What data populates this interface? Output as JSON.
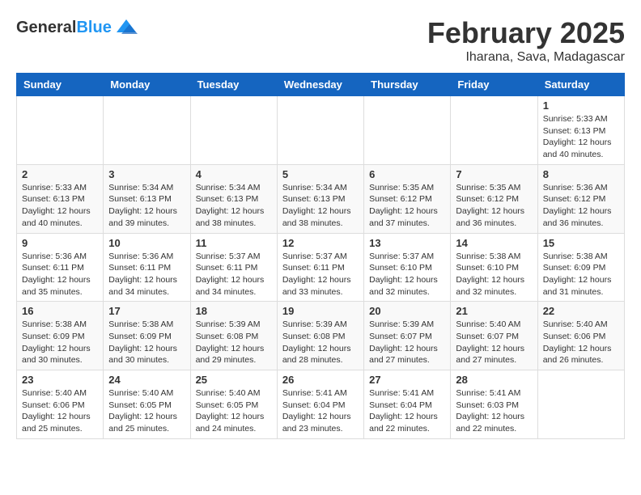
{
  "header": {
    "logo_line1": "General",
    "logo_line2": "Blue",
    "month": "February 2025",
    "location": "Iharana, Sava, Madagascar"
  },
  "days_of_week": [
    "Sunday",
    "Monday",
    "Tuesday",
    "Wednesday",
    "Thursday",
    "Friday",
    "Saturday"
  ],
  "weeks": [
    {
      "days": [
        {
          "num": "",
          "info": ""
        },
        {
          "num": "",
          "info": ""
        },
        {
          "num": "",
          "info": ""
        },
        {
          "num": "",
          "info": ""
        },
        {
          "num": "",
          "info": ""
        },
        {
          "num": "",
          "info": ""
        },
        {
          "num": "1",
          "info": "Sunrise: 5:33 AM\nSunset: 6:13 PM\nDaylight: 12 hours\nand 40 minutes."
        }
      ]
    },
    {
      "days": [
        {
          "num": "2",
          "info": "Sunrise: 5:33 AM\nSunset: 6:13 PM\nDaylight: 12 hours\nand 40 minutes."
        },
        {
          "num": "3",
          "info": "Sunrise: 5:34 AM\nSunset: 6:13 PM\nDaylight: 12 hours\nand 39 minutes."
        },
        {
          "num": "4",
          "info": "Sunrise: 5:34 AM\nSunset: 6:13 PM\nDaylight: 12 hours\nand 38 minutes."
        },
        {
          "num": "5",
          "info": "Sunrise: 5:34 AM\nSunset: 6:13 PM\nDaylight: 12 hours\nand 38 minutes."
        },
        {
          "num": "6",
          "info": "Sunrise: 5:35 AM\nSunset: 6:12 PM\nDaylight: 12 hours\nand 37 minutes."
        },
        {
          "num": "7",
          "info": "Sunrise: 5:35 AM\nSunset: 6:12 PM\nDaylight: 12 hours\nand 36 minutes."
        },
        {
          "num": "8",
          "info": "Sunrise: 5:36 AM\nSunset: 6:12 PM\nDaylight: 12 hours\nand 36 minutes."
        }
      ]
    },
    {
      "days": [
        {
          "num": "9",
          "info": "Sunrise: 5:36 AM\nSunset: 6:11 PM\nDaylight: 12 hours\nand 35 minutes."
        },
        {
          "num": "10",
          "info": "Sunrise: 5:36 AM\nSunset: 6:11 PM\nDaylight: 12 hours\nand 34 minutes."
        },
        {
          "num": "11",
          "info": "Sunrise: 5:37 AM\nSunset: 6:11 PM\nDaylight: 12 hours\nand 34 minutes."
        },
        {
          "num": "12",
          "info": "Sunrise: 5:37 AM\nSunset: 6:11 PM\nDaylight: 12 hours\nand 33 minutes."
        },
        {
          "num": "13",
          "info": "Sunrise: 5:37 AM\nSunset: 6:10 PM\nDaylight: 12 hours\nand 32 minutes."
        },
        {
          "num": "14",
          "info": "Sunrise: 5:38 AM\nSunset: 6:10 PM\nDaylight: 12 hours\nand 32 minutes."
        },
        {
          "num": "15",
          "info": "Sunrise: 5:38 AM\nSunset: 6:09 PM\nDaylight: 12 hours\nand 31 minutes."
        }
      ]
    },
    {
      "days": [
        {
          "num": "16",
          "info": "Sunrise: 5:38 AM\nSunset: 6:09 PM\nDaylight: 12 hours\nand 30 minutes."
        },
        {
          "num": "17",
          "info": "Sunrise: 5:38 AM\nSunset: 6:09 PM\nDaylight: 12 hours\nand 30 minutes."
        },
        {
          "num": "18",
          "info": "Sunrise: 5:39 AM\nSunset: 6:08 PM\nDaylight: 12 hours\nand 29 minutes."
        },
        {
          "num": "19",
          "info": "Sunrise: 5:39 AM\nSunset: 6:08 PM\nDaylight: 12 hours\nand 28 minutes."
        },
        {
          "num": "20",
          "info": "Sunrise: 5:39 AM\nSunset: 6:07 PM\nDaylight: 12 hours\nand 27 minutes."
        },
        {
          "num": "21",
          "info": "Sunrise: 5:40 AM\nSunset: 6:07 PM\nDaylight: 12 hours\nand 27 minutes."
        },
        {
          "num": "22",
          "info": "Sunrise: 5:40 AM\nSunset: 6:06 PM\nDaylight: 12 hours\nand 26 minutes."
        }
      ]
    },
    {
      "days": [
        {
          "num": "23",
          "info": "Sunrise: 5:40 AM\nSunset: 6:06 PM\nDaylight: 12 hours\nand 25 minutes."
        },
        {
          "num": "24",
          "info": "Sunrise: 5:40 AM\nSunset: 6:05 PM\nDaylight: 12 hours\nand 25 minutes."
        },
        {
          "num": "25",
          "info": "Sunrise: 5:40 AM\nSunset: 6:05 PM\nDaylight: 12 hours\nand 24 minutes."
        },
        {
          "num": "26",
          "info": "Sunrise: 5:41 AM\nSunset: 6:04 PM\nDaylight: 12 hours\nand 23 minutes."
        },
        {
          "num": "27",
          "info": "Sunrise: 5:41 AM\nSunset: 6:04 PM\nDaylight: 12 hours\nand 22 minutes."
        },
        {
          "num": "28",
          "info": "Sunrise: 5:41 AM\nSunset: 6:03 PM\nDaylight: 12 hours\nand 22 minutes."
        },
        {
          "num": "",
          "info": ""
        }
      ]
    }
  ]
}
